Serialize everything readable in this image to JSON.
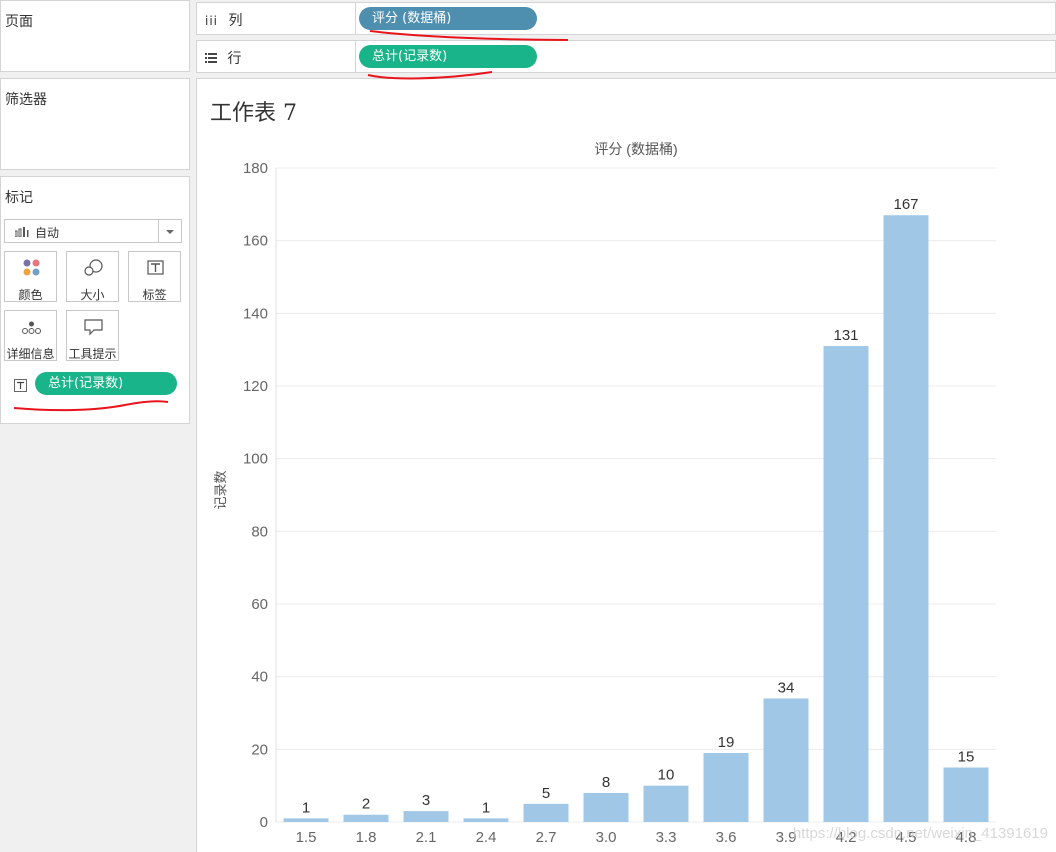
{
  "left_panel": {
    "pages_title": "页面",
    "filters_title": "筛选器",
    "marks_title": "标记",
    "mark_type": "自动",
    "mark_cards": [
      {
        "label": "颜色",
        "icon": "color-icon"
      },
      {
        "label": "大小",
        "icon": "size-icon"
      },
      {
        "label": "标签",
        "icon": "label-icon"
      },
      {
        "label": "详细信息",
        "icon": "detail-icon"
      },
      {
        "label": "工具提示",
        "icon": "tooltip-icon"
      }
    ],
    "mark_pill": "总计(记录数)"
  },
  "shelves": {
    "columns_label": "列",
    "columns_pill": "评分 (数据桶)",
    "rows_label": "行",
    "rows_pill": "总计(记录数)"
  },
  "sheet_title": "工作表 7",
  "colors": {
    "bar": "#a0c8e6",
    "pill_green": "#19b489",
    "pill_blue": "#4e8fb0",
    "annotation_red": "#e8141c"
  },
  "chart_data": {
    "type": "bar",
    "title": "评分 (数据桶)",
    "ylabel": "记录数",
    "xlabel": "",
    "categories": [
      "1.5",
      "1.8",
      "2.1",
      "2.4",
      "2.7",
      "3.0",
      "3.3",
      "3.6",
      "3.9",
      "4.2",
      "4.5",
      "4.8"
    ],
    "values": [
      1,
      2,
      3,
      1,
      5,
      8,
      10,
      19,
      34,
      131,
      167,
      15
    ],
    "ylim": [
      0,
      180
    ],
    "yticks": [
      0,
      20,
      40,
      60,
      80,
      100,
      120,
      140,
      160,
      180
    ],
    "data_labels": true,
    "grid": true
  },
  "watermark": "https://blog.csdn.net/weixin_41391619"
}
